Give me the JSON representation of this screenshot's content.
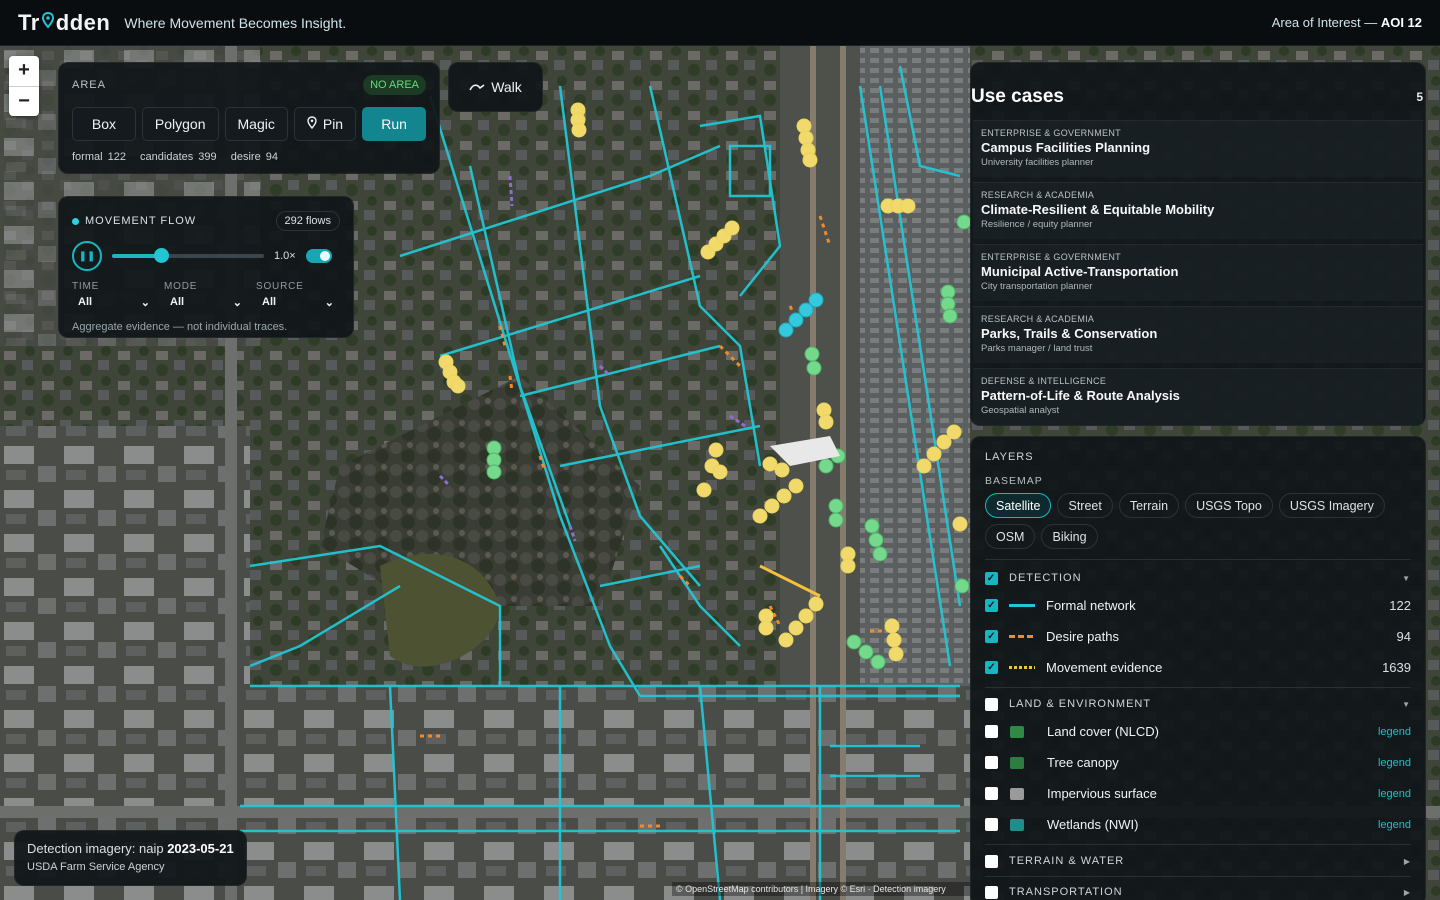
{
  "header": {
    "brand_left": "Tr",
    "brand_right": "dden",
    "tagline": "Where Movement Becomes Insight.",
    "aoi_prefix": "Area of Interest — ",
    "aoi_value": "AOI 12"
  },
  "zoom": {
    "plus": "+",
    "minus": "−"
  },
  "area": {
    "title": "AREA",
    "status": "NO AREA",
    "tools": [
      "Box",
      "Polygon",
      "Magic",
      "Pin"
    ],
    "run_label": "Run",
    "stats": {
      "formal": "formal 122",
      "candidates": "candidates 399",
      "desire": "desire 94"
    }
  },
  "walk": {
    "label": "Walk"
  },
  "movement_flow": {
    "title": "MOVEMENT FLOW",
    "flows": "292 flows",
    "speed": "1.0×",
    "progress": 0.32,
    "filters": [
      {
        "label": "TIME",
        "value": "All"
      },
      {
        "label": "MODE",
        "value": "All"
      },
      {
        "label": "SOURCE",
        "value": "All"
      }
    ],
    "note": "Aggregate evidence — not individual traces."
  },
  "use_cases": {
    "title": "Use cases",
    "count": "5",
    "items": [
      {
        "category": "ENTERPRISE & GOVERNMENT",
        "name": "Campus Facilities Planning",
        "role": "University facilities planner"
      },
      {
        "category": "RESEARCH & ACADEMIA",
        "name": "Climate-Resilient & Equitable Mobility",
        "role": "Resilience / equity planner"
      },
      {
        "category": "ENTERPRISE & GOVERNMENT",
        "name": "Municipal Active-Transportation",
        "role": "City transportation planner"
      },
      {
        "category": "RESEARCH & ACADEMIA",
        "name": "Parks, Trails & Conservation",
        "role": "Parks manager / land trust"
      },
      {
        "category": "DEFENSE & INTELLIGENCE",
        "name": "Pattern-of-Life & Route Analysis",
        "role": "Geospatial analyst"
      }
    ]
  },
  "layers": {
    "title": "LAYERS",
    "basemap_title": "BASEMAP",
    "basemaps": [
      "Satellite",
      "Street",
      "Terrain",
      "USGS Topo",
      "USGS Imagery",
      "OSM",
      "Biking"
    ],
    "basemap_selected": "Satellite",
    "detection": {
      "title": "DETECTION",
      "items": [
        {
          "label": "Formal network",
          "count": "122",
          "color": "#22c6d4"
        },
        {
          "label": "Desire paths",
          "count": "94",
          "color": "#f08a2c"
        },
        {
          "label": "Movement evidence",
          "count": "1639",
          "color": "#f4c13a"
        }
      ]
    },
    "land": {
      "title": "LAND & ENVIRONMENT",
      "items": [
        {
          "label": "Land cover (NLCD)",
          "legend": "legend",
          "color": "#2f8a45"
        },
        {
          "label": "Tree canopy",
          "legend": "legend",
          "color": "#2e7d3e"
        },
        {
          "label": "Impervious surface",
          "legend": "legend",
          "color": "#9a9a9a"
        },
        {
          "label": "Wetlands (NWI)",
          "legend": "legend",
          "color": "#1e8f88"
        }
      ]
    },
    "terrain_title": "TERRAIN & WATER",
    "transport_title": "TRANSPORTATION"
  },
  "detection_card": {
    "prefix": "Detection imagery: naip ",
    "date": "2023-05-21",
    "agency": "USDA Farm Service Agency"
  },
  "attribution": "© OpenStreetMap contributors | Imagery © Esri · Detection imagery",
  "colors": {
    "accent": "#18b6c2",
    "formal": "#22c6d4",
    "desire": "#f08a2c",
    "evidence": "#f4c13a"
  }
}
